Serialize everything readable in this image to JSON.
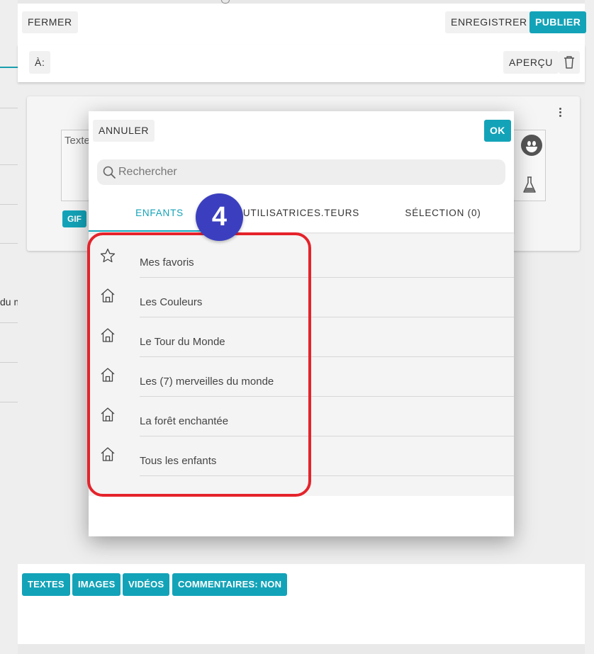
{
  "header": {
    "close_label": "FERMER",
    "save_label": "ENREGISTRER",
    "publish_label": "PUBLIER",
    "to_label": "À:",
    "preview_label": "APERÇU"
  },
  "background": {
    "text_fragment": "du m",
    "editor_placeholder": "Texte",
    "gif_label": "GIF"
  },
  "bottom_toolbar": {
    "texts_label": "TEXTES",
    "images_label": "IMAGES",
    "videos_label": "VIDÉOS",
    "comments_label": "COMMENTAIRES: NON"
  },
  "dialog": {
    "cancel_label": "ANNULER",
    "ok_label": "OK",
    "search_placeholder": "Rechercher",
    "tabs": [
      {
        "label": "ENFANTS",
        "active": true
      },
      {
        "label": "UTILISATRICES.TEURS",
        "active": false
      },
      {
        "label": "SÉLECTION (0)",
        "active": false
      }
    ],
    "items": [
      {
        "label": "Mes favoris",
        "icon": "star-icon"
      },
      {
        "label": "Les Couleurs",
        "icon": "house-icon"
      },
      {
        "label": "Le Tour du Monde",
        "icon": "house-icon"
      },
      {
        "label": "Les (7) merveilles du monde",
        "icon": "house-icon"
      },
      {
        "label": "La forêt enchantée",
        "icon": "house-icon"
      },
      {
        "label": "Tous les enfants",
        "icon": "house-icon"
      }
    ]
  },
  "annotation": {
    "step_number": "4",
    "highlight_color": "#e5232b",
    "badge_color": "#3b3fbf"
  },
  "colors": {
    "accent": "#13a3b8"
  }
}
